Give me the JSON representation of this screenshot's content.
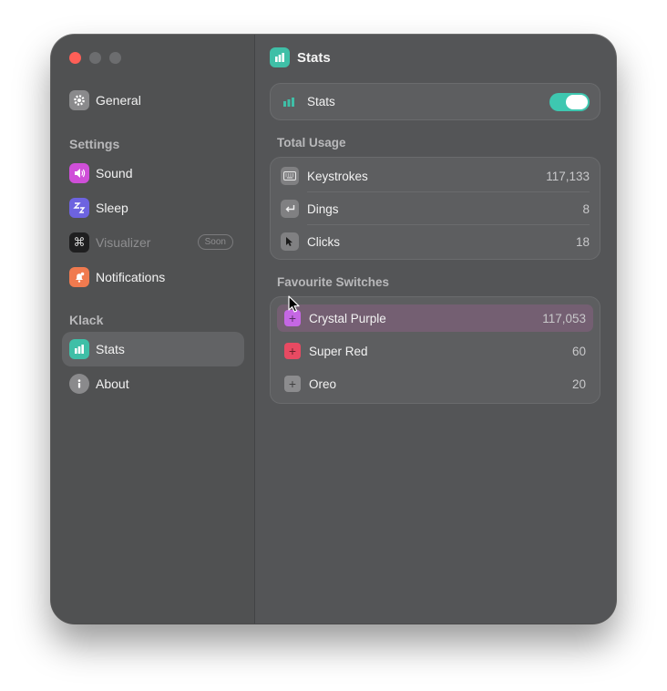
{
  "sidebar": {
    "items": [
      {
        "label": "General",
        "icon": "gear-icon",
        "color": "#8a8a8c"
      },
      {
        "label": "Sound",
        "icon": "speaker-icon",
        "color": "#cf4fd8"
      },
      {
        "label": "Sleep",
        "icon": "sleep-zz-icon",
        "color": "#6d63e0"
      },
      {
        "label": "Visualizer",
        "icon": "command-icon",
        "color": "#1f1f20",
        "badge": "Soon"
      },
      {
        "label": "Notifications",
        "icon": "bell-icon",
        "color": "#f07a4f"
      },
      {
        "label": "Stats",
        "icon": "bar-chart-icon",
        "color": "#3fbfa7"
      },
      {
        "label": "About",
        "icon": "info-icon",
        "color": "#8a8a8c"
      }
    ],
    "sections": {
      "settings": "Settings",
      "klack": "Klack"
    }
  },
  "header": {
    "title": "Stats"
  },
  "stats_toggle": {
    "label": "Stats",
    "on": true,
    "accent": "#3ec7b0"
  },
  "total_usage": {
    "title": "Total Usage",
    "rows": [
      {
        "label": "Keystrokes",
        "value": "117,133",
        "icon": "keyboard-icon"
      },
      {
        "label": "Dings",
        "value": "8",
        "icon": "return-key-icon"
      },
      {
        "label": "Clicks",
        "value": "18",
        "icon": "pointer-icon"
      }
    ]
  },
  "favourite_switches": {
    "title": "Favourite Switches",
    "rows": [
      {
        "label": "Crystal Purple",
        "value": "117,053",
        "color": "#c567e4"
      },
      {
        "label": "Super Red",
        "value": "60",
        "color": "#e84a62"
      },
      {
        "label": "Oreo",
        "value": "20",
        "color": "#8c8c8e"
      }
    ]
  }
}
